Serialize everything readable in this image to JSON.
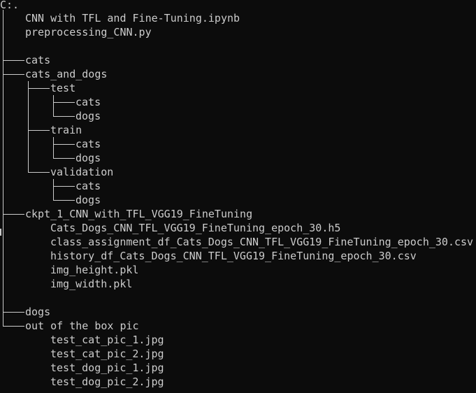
{
  "terminal": {
    "root": "C:.",
    "lines": [
      "CNN with TFL and Fine-Tuning.ipynb",
      "preprocessing_CNN.py",
      "cats",
      "cats_and_dogs",
      "test",
      "cats",
      "dogs",
      "train",
      "cats",
      "dogs",
      "validation",
      "cats",
      "dogs",
      "ckpt_1_CNN_with_TFL_VGG19_FineTuning",
      "Cats_Dogs_CNN_TFL_VGG19_FineTuning_epoch_30.h5",
      "class_assignment_df_Cats_Dogs_CNN_TFL_VGG19_FineTuning_epoch_30.csv",
      "history_df_Cats_Dogs_CNN_TFL_VGG19_FineTuning_epoch_30.csv",
      "img_height.pkl",
      "img_width.pkl",
      "dogs",
      "out of the box pic",
      "test_cat_pic_1.jpg",
      "test_cat_pic_2.jpg",
      "test_dog_pic_1.jpg",
      "test_dog_pic_2.jpg"
    ]
  },
  "colors": {
    "background": "#0c0c0c",
    "foreground": "#cccccc"
  }
}
